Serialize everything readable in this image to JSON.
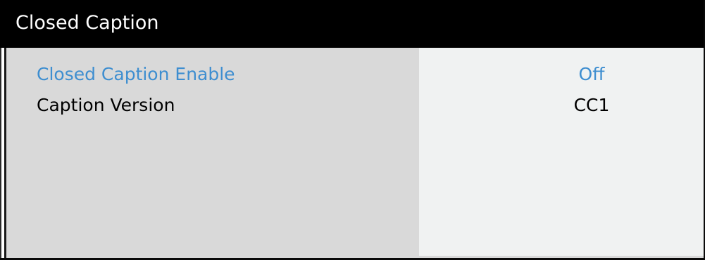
{
  "window": {
    "title": "Closed Caption"
  },
  "menu": {
    "items": [
      {
        "label": "Closed Caption Enable",
        "value": "Off",
        "selected": true
      },
      {
        "label": "Caption Version",
        "value": "CC1",
        "selected": false
      }
    ]
  },
  "colors": {
    "title_bar": "#000000",
    "title_text": "#ffffff",
    "menu_panel": "#d9d9d9",
    "value_panel": "#f0f2f2",
    "highlight": "#3e8ed0",
    "text": "#000000"
  }
}
